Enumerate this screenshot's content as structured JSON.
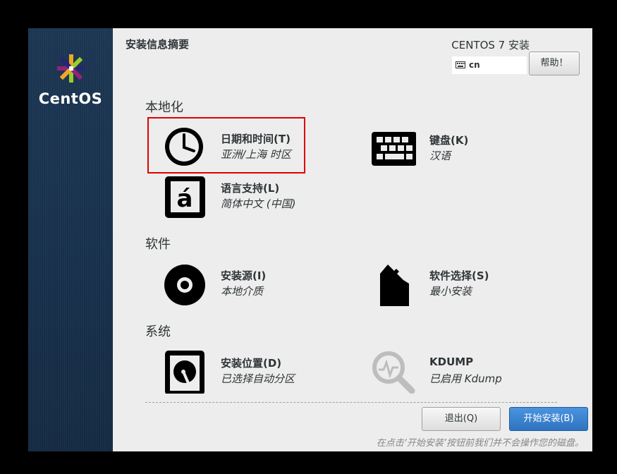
{
  "sidebar": {
    "logo_text": "CentOS"
  },
  "header": {
    "title": "安装信息摘要",
    "product": "CENTOS 7 安装",
    "keyboard_layout": "cn",
    "help_label": "帮助！"
  },
  "sections": {
    "localization": "本地化",
    "software": "软件",
    "system": "系统"
  },
  "spokes": {
    "datetime": {
      "title": "日期和时间(T)",
      "status": "亚洲/上海 时区",
      "icon": "clock-icon"
    },
    "keyboard": {
      "title": "键盘(K)",
      "status": "汉语",
      "icon": "keyboard-icon"
    },
    "language": {
      "title": "语言支持(L)",
      "status": "简体中文 (中国)",
      "icon": "language-icon"
    },
    "source": {
      "title": "安装源(I)",
      "status": "本地介质",
      "icon": "disc-icon"
    },
    "software": {
      "title": "软件选择(S)",
      "status": "最小安装",
      "icon": "package-icon"
    },
    "destination": {
      "title": "安装位置(D)",
      "status": "已选择自动分区",
      "icon": "harddisk-icon"
    },
    "kdump": {
      "title": "KDUMP",
      "status": "已启用 Kdump",
      "icon": "search-icon"
    }
  },
  "footer": {
    "quit_label": "退出(Q)",
    "begin_label": "开始安装(B)",
    "note": "在点击‘开始安装’按钮前我们并不会操作您的磁盘。"
  },
  "colors": {
    "highlight": "#e00000",
    "primary_button": "#3a84d0",
    "sidebar": "#1b3552"
  }
}
